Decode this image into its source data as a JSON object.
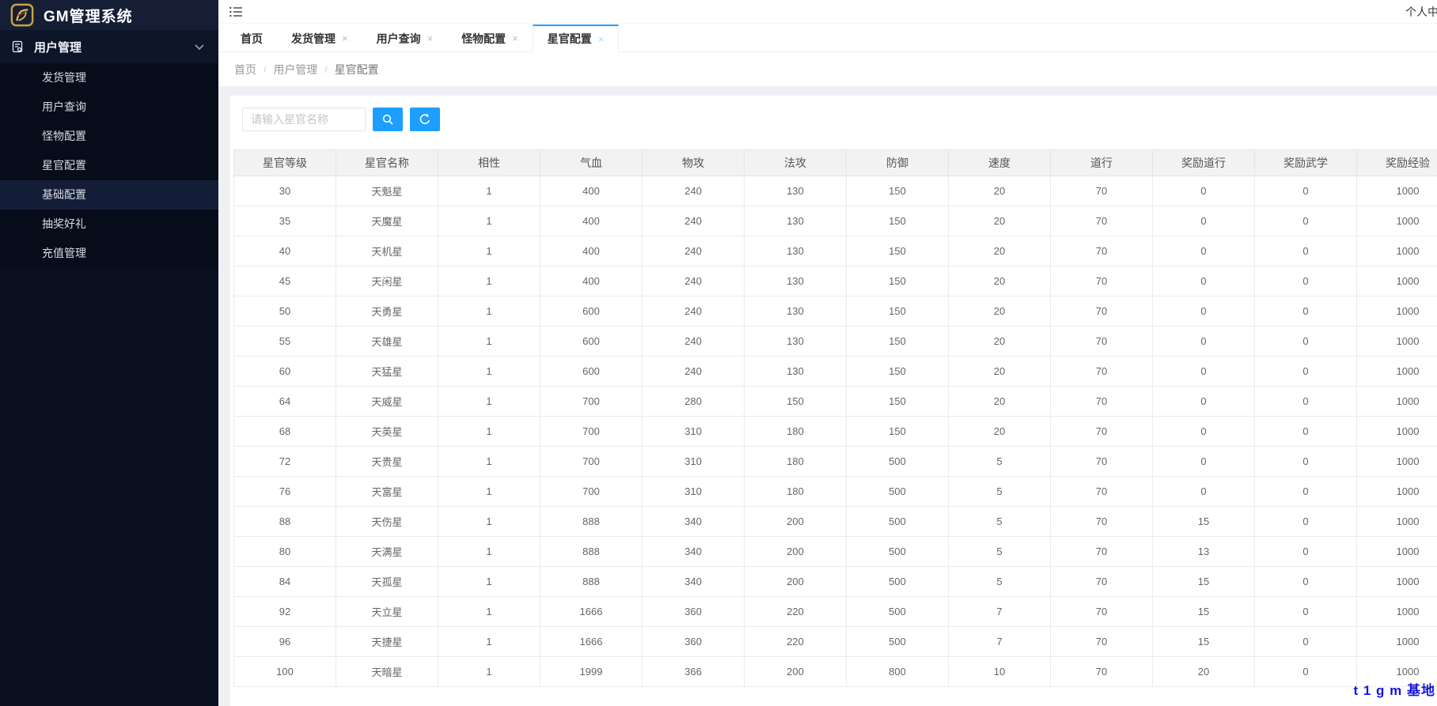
{
  "app": {
    "title": "GM管理系统",
    "user_menu": "个人中心"
  },
  "sidebar": {
    "group_label": "用户管理",
    "items": [
      {
        "label": "发货管理"
      },
      {
        "label": "用户查询"
      },
      {
        "label": "怪物配置"
      },
      {
        "label": "星官配置"
      },
      {
        "label": "基础配置",
        "highlighted": true
      },
      {
        "label": "抽奖好礼"
      },
      {
        "label": "充值管理"
      }
    ]
  },
  "tabs": [
    {
      "label": "首页",
      "closable": false,
      "active": false
    },
    {
      "label": "发货管理",
      "closable": true,
      "active": false
    },
    {
      "label": "用户查询",
      "closable": true,
      "active": false
    },
    {
      "label": "怪物配置",
      "closable": true,
      "active": false
    },
    {
      "label": "星官配置",
      "closable": true,
      "active": true
    }
  ],
  "breadcrumb": {
    "items": [
      "首页",
      "用户管理",
      "星官配置"
    ],
    "separator": "/"
  },
  "toolbar": {
    "search_placeholder": "请输入星官名称"
  },
  "table": {
    "headers": [
      "星官等级",
      "星官名称",
      "相性",
      "气血",
      "物攻",
      "法攻",
      "防御",
      "速度",
      "道行",
      "奖励道行",
      "奖励武学",
      "奖励经验"
    ],
    "rows": [
      [
        "30",
        "天魁星",
        "1",
        "400",
        "240",
        "130",
        "150",
        "20",
        "70",
        "0",
        "0",
        "1000"
      ],
      [
        "35",
        "天魔星",
        "1",
        "400",
        "240",
        "130",
        "150",
        "20",
        "70",
        "0",
        "0",
        "1000"
      ],
      [
        "40",
        "天机星",
        "1",
        "400",
        "240",
        "130",
        "150",
        "20",
        "70",
        "0",
        "0",
        "1000"
      ],
      [
        "45",
        "天闲星",
        "1",
        "400",
        "240",
        "130",
        "150",
        "20",
        "70",
        "0",
        "0",
        "1000"
      ],
      [
        "50",
        "天勇星",
        "1",
        "600",
        "240",
        "130",
        "150",
        "20",
        "70",
        "0",
        "0",
        "1000"
      ],
      [
        "55",
        "天雄星",
        "1",
        "600",
        "240",
        "130",
        "150",
        "20",
        "70",
        "0",
        "0",
        "1000"
      ],
      [
        "60",
        "天猛星",
        "1",
        "600",
        "240",
        "130",
        "150",
        "20",
        "70",
        "0",
        "0",
        "1000"
      ],
      [
        "64",
        "天威星",
        "1",
        "700",
        "280",
        "150",
        "150",
        "20",
        "70",
        "0",
        "0",
        "1000"
      ],
      [
        "68",
        "天英星",
        "1",
        "700",
        "310",
        "180",
        "150",
        "20",
        "70",
        "0",
        "0",
        "1000"
      ],
      [
        "72",
        "天贵星",
        "1",
        "700",
        "310",
        "180",
        "500",
        "5",
        "70",
        "0",
        "0",
        "1000"
      ],
      [
        "76",
        "天富星",
        "1",
        "700",
        "310",
        "180",
        "500",
        "5",
        "70",
        "0",
        "0",
        "1000"
      ],
      [
        "88",
        "天伤星",
        "1",
        "888",
        "340",
        "200",
        "500",
        "5",
        "70",
        "15",
        "0",
        "1000"
      ],
      [
        "80",
        "天满星",
        "1",
        "888",
        "340",
        "200",
        "500",
        "5",
        "70",
        "13",
        "0",
        "1000"
      ],
      [
        "84",
        "天孤星",
        "1",
        "888",
        "340",
        "200",
        "500",
        "5",
        "70",
        "15",
        "0",
        "1000"
      ],
      [
        "92",
        "天立星",
        "1",
        "1666",
        "360",
        "220",
        "500",
        "7",
        "70",
        "15",
        "0",
        "1000"
      ],
      [
        "96",
        "天捷星",
        "1",
        "1666",
        "360",
        "220",
        "500",
        "7",
        "70",
        "15",
        "0",
        "1000"
      ],
      [
        "100",
        "天暗星",
        "1",
        "1999",
        "366",
        "200",
        "800",
        "10",
        "70",
        "20",
        "0",
        "1000"
      ]
    ]
  },
  "watermark": {
    "text": "t 1 g m 基地",
    "color": "#1515dd"
  },
  "icons": {
    "close": "×"
  },
  "colors": {
    "accent": "#1e9fff",
    "sidebar_bg": "#0a101f",
    "table_header_bg": "#f2f2f2"
  }
}
